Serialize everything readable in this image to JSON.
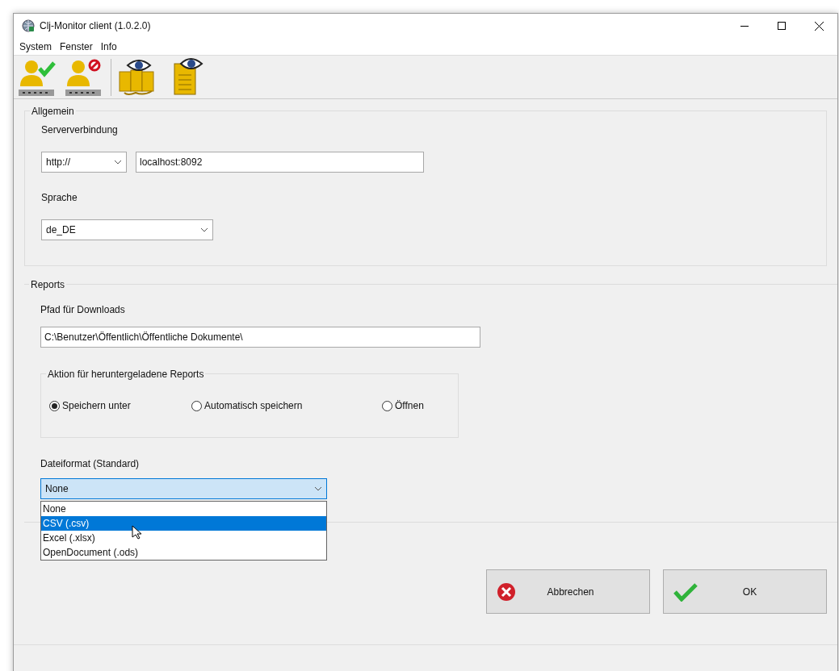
{
  "window": {
    "title": "Clj-Monitor  client (1.0.2.0)"
  },
  "menu": [
    {
      "label": "System"
    },
    {
      "label": "Fenster"
    },
    {
      "label": "Info"
    }
  ],
  "general": {
    "title": "Allgemein",
    "server_label": "Serververbindung",
    "protocol": {
      "value": "http://"
    },
    "host": {
      "value": "localhost:8092"
    },
    "language_label": "Sprache",
    "language": {
      "value": "de_DE"
    }
  },
  "reports": {
    "title": "Reports",
    "path_label": "Pfad für Downloads",
    "path": {
      "value": "C:\\Benutzer\\Öffentlich\\Öffentliche Dokumente\\"
    },
    "action_group": {
      "title": "Aktion für heruntergeladene Reports",
      "options": [
        {
          "label": "Speichern unter",
          "selected": true
        },
        {
          "label": "Automatisch speichern",
          "selected": false
        },
        {
          "label": "Öffnen",
          "selected": false
        }
      ]
    },
    "format_label": "Dateiformat (Standard)",
    "format": {
      "value": "None",
      "expanded": true,
      "options": [
        {
          "label": "None",
          "highlighted": false
        },
        {
          "label": "CSV (.csv)",
          "highlighted": true
        },
        {
          "label": "Excel (.xlsx)",
          "highlighted": false
        },
        {
          "label": "OpenDocument (.ods)",
          "highlighted": false
        }
      ]
    }
  },
  "buttons": [
    {
      "label": "Abbrechen",
      "kind": "cancel"
    },
    {
      "label": "OK",
      "kind": "ok"
    }
  ]
}
